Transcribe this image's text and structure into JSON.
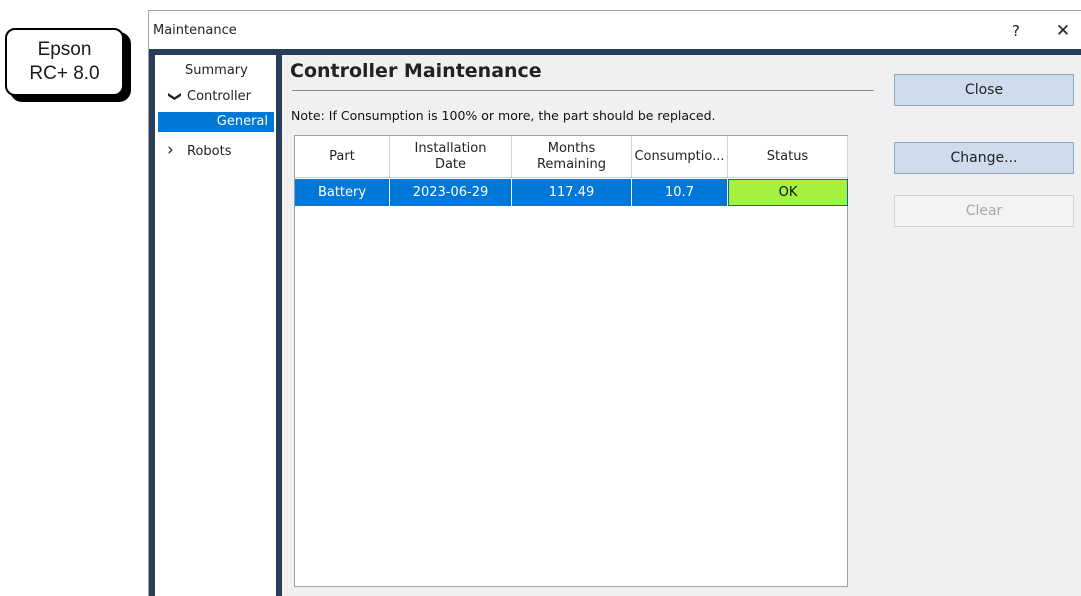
{
  "callout": {
    "line1": "Epson",
    "line2": "RC+ 8.0"
  },
  "window": {
    "title": "Maintenance",
    "help_label": "?",
    "close_label": "✕"
  },
  "nav": {
    "summary": "Summary",
    "controller": "Controller",
    "controller_chevron": "❯",
    "general": "General",
    "robots": "Robots",
    "robots_chevron": "›"
  },
  "main": {
    "title": "Controller Maintenance",
    "note": "Note: If Consumption is 100% or more, the part should be replaced."
  },
  "grid": {
    "headers": {
      "part": "Part",
      "install_line1": "Installation",
      "install_line2": "Date",
      "months_line1": "Months",
      "months_line2": "Remaining",
      "consumption": "Consumptio...",
      "status": "Status"
    },
    "rows": [
      {
        "part": "Battery",
        "installation_date": "2023-06-29",
        "months_remaining": "117.49",
        "consumption": "10.7",
        "status": "OK"
      }
    ]
  },
  "buttons": {
    "close": "Close",
    "change": "Change...",
    "clear": "Clear"
  },
  "colors": {
    "selection": "#0078d7",
    "status_ok": "#a4f23e",
    "window_frame": "#283d59",
    "button_face": "#cfdcee"
  }
}
